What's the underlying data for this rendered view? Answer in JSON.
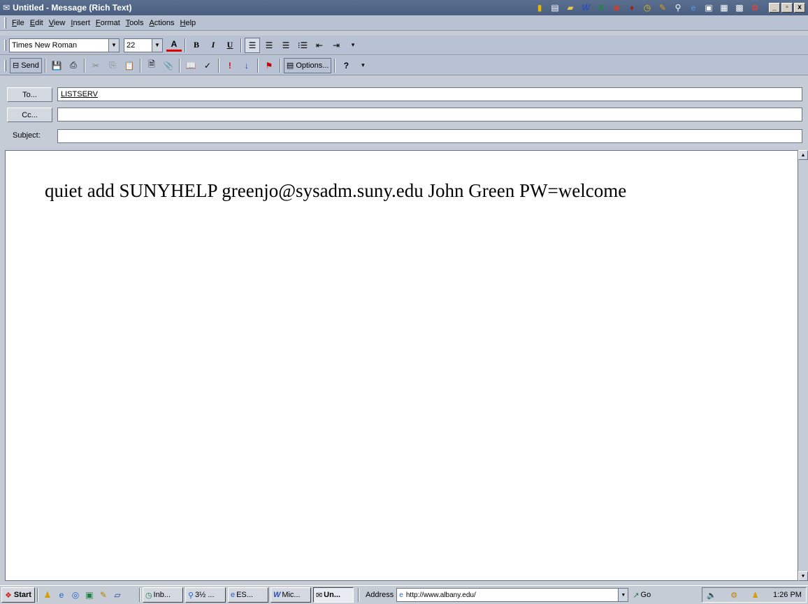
{
  "window": {
    "title": "Untitled - Message (Rich Text)",
    "controls": [
      "_",
      "▫",
      "x"
    ]
  },
  "quick_launch_icons": [
    "office-bar-icon",
    "office-icon",
    "folder-icon",
    "word-icon",
    "excel-icon",
    "powerpoint-icon",
    "access-icon",
    "outlook-icon",
    "binder-icon",
    "search-icon",
    "ie-icon",
    "msn-icon",
    "calendar-icon",
    "dos-icon",
    "publisher-icon"
  ],
  "menu": {
    "items": [
      "File",
      "Edit",
      "View",
      "Insert",
      "Format",
      "Tools",
      "Actions",
      "Help"
    ]
  },
  "format_toolbar": {
    "font": "Times New Roman",
    "size": "22",
    "bold": "B",
    "italic": "I",
    "underline": "U"
  },
  "standard_toolbar": {
    "send": "Send",
    "options": "Options..."
  },
  "header": {
    "to_label": "To...",
    "to_value": "LISTSERV",
    "cc_label": "Cc...",
    "cc_value": "",
    "subject_label": "Subject:",
    "subject_value": ""
  },
  "body": {
    "text": "quiet add SUNYHELP greenjo@sysadm.suny.edu John Green PW=welcome"
  },
  "taskbar": {
    "start": "Start",
    "tasks": [
      "Inb...",
      "3½ ...",
      "ES...",
      "Mic...",
      "Un..."
    ],
    "address_label": "Address",
    "address_value": "http://www.albany.edu/",
    "go": "Go",
    "clock": "1:26 PM"
  }
}
